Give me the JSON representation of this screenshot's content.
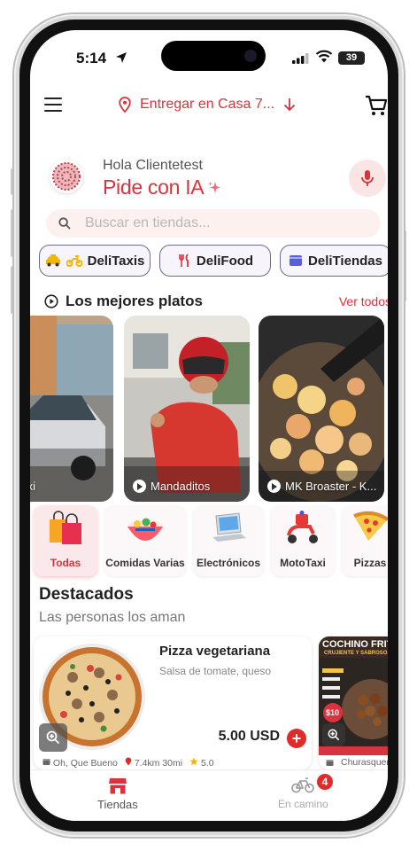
{
  "status_bar": {
    "time": "5:14",
    "battery": "39"
  },
  "header": {
    "deliver_label": "Entregar en Casa 7...",
    "icons": [
      "menu-icon",
      "location-pin-icon",
      "arrow-down-icon",
      "cart-icon"
    ]
  },
  "greeting": {
    "hello": "Hola Clientetest",
    "cta": "Pide con IA"
  },
  "search": {
    "placeholder": "Buscar en tiendas..."
  },
  "chips": [
    {
      "label": "DeliTaxis",
      "icons": [
        "taxi-icon",
        "motorbike-icon"
      ]
    },
    {
      "label": "DeliFood",
      "icons": [
        "fork-knife-icon"
      ]
    },
    {
      "label": "DeliTiendas",
      "icons": [
        "store-icon"
      ]
    }
  ],
  "best_dishes": {
    "title": "Los mejores platos",
    "see_all": "Ver todos",
    "stories": [
      {
        "label": "litaxi"
      },
      {
        "label": "Mandaditos"
      },
      {
        "label": "MK Broaster - K..."
      }
    ]
  },
  "categories": [
    {
      "label": "Todas",
      "active": true
    },
    {
      "label": "Comidas Varias",
      "active": false
    },
    {
      "label": "Electrónicos",
      "active": false
    },
    {
      "label": "MotoTaxi",
      "active": false
    },
    {
      "label": "Pizzas",
      "active": false
    }
  ],
  "featured": {
    "title": "Destacados",
    "subtitle": "Las personas los aman",
    "products": [
      {
        "name": "Pizza vegetariana",
        "description": "Salsa de tomate, queso",
        "price": "5.00 USD",
        "store": "Oh, Que Bueno",
        "distance": "7.4km 30mi",
        "rating": "5.0"
      },
      {
        "poster_title": "COCHINO FRITO",
        "poster_subtitle": "CRUJIENTE Y SABROSO",
        "poster_price": "$10",
        "store": "Churasqueria"
      }
    ]
  },
  "bottom_nav": {
    "tabs": [
      {
        "label": "Tiendas",
        "active": true
      },
      {
        "label": "En camino",
        "active": false,
        "badge": "4"
      }
    ]
  },
  "colors": {
    "accent": "#d9333d",
    "chip_border": "#6b6b8b",
    "search_bg": "#fdf1ef"
  }
}
